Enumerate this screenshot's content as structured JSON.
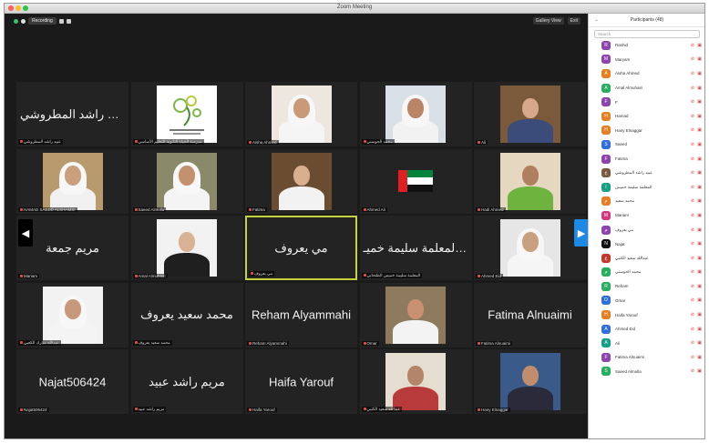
{
  "window": {
    "title": "Zoom Meeting"
  },
  "topbar": {
    "recording_label": "Recording",
    "view_label": "Gallery View",
    "fullscreen_label": "Exit"
  },
  "panel": {
    "title": "Participants (48)",
    "search_placeholder": "Search"
  },
  "tiles": [
    {
      "name": "عبيد راشد المطروشي",
      "label": "عبيد راشد المطروشي",
      "type": "text"
    },
    {
      "name": "",
      "label": "مدرسة الحياة الثانوية للتعليم الأساسي",
      "type": "logo"
    },
    {
      "name": "",
      "label": "Aisha Ahmed",
      "type": "person",
      "skin": "#c99a78",
      "bg": "#ede7e0",
      "dress": "#f5f5f5",
      "ghutra": true
    },
    {
      "name": "",
      "label": "محمد الحوسني",
      "type": "person",
      "skin": "#b98566",
      "bg": "#d9dfe6",
      "dress": "#f2f2f2",
      "ghutra": true
    },
    {
      "name": "",
      "label": "Ali",
      "type": "person",
      "skin": "#d6a98a",
      "bg": "#7a5a3a",
      "dress": "#3b4c7a",
      "ghutra": false
    },
    {
      "name": "",
      "label": "HAMAD SAEED ALSHAMSI",
      "type": "person",
      "skin": "#caa07c",
      "bg": "#b89a6c",
      "dress": "#f0f0f0",
      "ghutra": true
    },
    {
      "name": "",
      "label": "Saeed Almulla",
      "type": "person",
      "skin": "#c4916e",
      "bg": "#8a8a6a",
      "dress": "#f4f4f4",
      "ghutra": true
    },
    {
      "name": "",
      "label": "Fatima",
      "type": "person",
      "skin": "#d8b090",
      "bg": "#6a4c30",
      "dress": "#f2f2f2",
      "ghutra": false
    },
    {
      "name": "",
      "label": "Ahmed Ali",
      "type": "flag"
    },
    {
      "name": "",
      "label": "Hadi Ahmed",
      "type": "person",
      "skin": "#b07f5f",
      "bg": "#e6d8c0",
      "dress": "#6fb33f",
      "ghutra": false
    },
    {
      "name": "مريم جمعة",
      "label": "Mariam",
      "type": "text"
    },
    {
      "name": "",
      "label": "Amal Almuhairi",
      "type": "person",
      "skin": "#d9b294",
      "bg": "#f2f2f2",
      "dress": "#1f1f1f",
      "ghutra": false
    },
    {
      "name": "مي يعروف",
      "label": "مي يعروف",
      "type": "text"
    },
    {
      "name": "المعلمة سليمة خميـ...",
      "label": "المعلمة سليمة خميس الظنحاني",
      "type": "text"
    },
    {
      "name": "",
      "label": "Ahmed Eid",
      "type": "person",
      "skin": "#c9a07e",
      "bg": "#e6e6e6",
      "dress": "#f5f5f5",
      "ghutra": true
    },
    {
      "name": "",
      "label": "عبدالله مبارك الكعبي",
      "type": "person",
      "skin": "#c7987a",
      "bg": "#f2f2f2",
      "dress": "#f4f4f4",
      "ghutra": true
    },
    {
      "name": "محمد سعيد يعروف",
      "label": "محمد سعيد يعروف",
      "type": "text"
    },
    {
      "name": "Reham Alyammahi",
      "label": "Reham Alyammahi",
      "type": "text"
    },
    {
      "name": "",
      "label": "Omar",
      "type": "person",
      "skin": "#c99072",
      "bg": "#8e7b5e",
      "dress": "#f3f3f3",
      "ghutra": false
    },
    {
      "name": "Fatima Alnuaimi",
      "label": "Fatima Alnuaimi",
      "type": "text"
    },
    {
      "name": "Najat506424",
      "label": "Najat506424",
      "type": "text"
    },
    {
      "name": "مريم راشد عبيد",
      "label": "مريم راشد عبيد",
      "type": "text"
    },
    {
      "name": "Haifa Yarouf",
      "label": "Haifa Yarouf",
      "type": "text"
    },
    {
      "name": "",
      "label": "عبدالله سعيد الكتبي",
      "type": "person",
      "skin": "#b5856a",
      "bg": "#e4ddd0",
      "dress": "#b83a3a",
      "ghutra": false
    },
    {
      "name": "",
      "label": "Hany Elnaggar",
      "type": "person",
      "skin": "#c28d6d",
      "bg": "#3a5a8a",
      "dress": "#2a2a3a",
      "ghutra": false
    }
  ],
  "participants": [
    {
      "initial": "R",
      "name": "Rashid",
      "color": "#8e44ad"
    },
    {
      "initial": "M",
      "name": "Maryam",
      "color": "#8e44ad"
    },
    {
      "initial": "A",
      "name": "Aisha Ahmed",
      "color": "#e67e22"
    },
    {
      "initial": "A",
      "name": "Amal Almuhairi",
      "color": "#27ae60"
    },
    {
      "initial": "F",
      "name": "F",
      "color": "#8e44ad"
    },
    {
      "initial": "H",
      "name": "Hamad",
      "color": "#e67e22"
    },
    {
      "initial": "H",
      "name": "Hany Elnaggar",
      "color": "#e67e22"
    },
    {
      "initial": "S",
      "name": "Saeed",
      "color": "#2e6fd9"
    },
    {
      "initial": "F",
      "name": "Fatima",
      "color": "#8e44ad"
    },
    {
      "initial": "ع",
      "name": "عبيد راشد المطروشي",
      "color": "#7b5a3a"
    },
    {
      "initial": "ا",
      "name": "المعلمة سليمة خميس",
      "color": "#16a085"
    },
    {
      "initial": "م",
      "name": "محمد سعيد",
      "color": "#e67e22"
    },
    {
      "initial": "M",
      "name": "Mariam",
      "color": "#d4377d"
    },
    {
      "initial": "م",
      "name": "مي يعروف",
      "color": "#8e44ad"
    },
    {
      "initial": "N",
      "name": "Najat",
      "color": "#111111"
    },
    {
      "initial": "ع",
      "name": "عبدالله سعيد الكتبي",
      "color": "#c0392b"
    },
    {
      "initial": "م",
      "name": "محمد الحوسني",
      "color": "#27ae60"
    },
    {
      "initial": "R",
      "name": "Reham",
      "color": "#27ae60"
    },
    {
      "initial": "O",
      "name": "Omar",
      "color": "#2e6fd9"
    },
    {
      "initial": "H",
      "name": "Haifa Yarouf",
      "color": "#e67e22"
    },
    {
      "initial": "A",
      "name": "Ahmed Eid",
      "color": "#2e6fd9"
    },
    {
      "initial": "A",
      "name": "Ali",
      "color": "#16a085"
    },
    {
      "initial": "F",
      "name": "Fatima Alnuaimi",
      "color": "#8e44ad"
    },
    {
      "initial": "S",
      "name": "Saeed Almulla",
      "color": "#27ae60"
    }
  ]
}
